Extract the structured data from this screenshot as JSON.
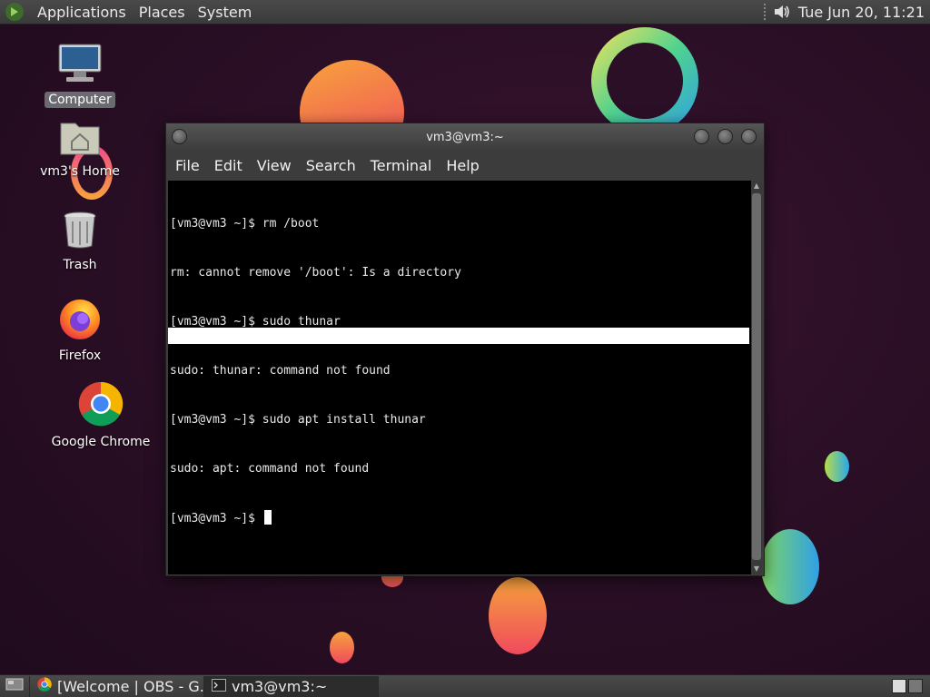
{
  "top_panel": {
    "menus": [
      "Applications",
      "Places",
      "System"
    ],
    "clock": "Tue Jun 20, 11:21"
  },
  "desktop": {
    "icons": [
      {
        "label": "Computer",
        "icon": "computer-icon",
        "selected": true
      },
      {
        "label": "vm3's Home",
        "icon": "home-folder-icon",
        "selected": false
      },
      {
        "label": "Trash",
        "icon": "trash-icon",
        "selected": false
      },
      {
        "label": "Firefox",
        "icon": "firefox-icon",
        "selected": false
      },
      {
        "label": "Google Chrome",
        "icon": "chrome-icon",
        "selected": false
      }
    ]
  },
  "terminal": {
    "title": "vm3@vm3:~",
    "menu": [
      "File",
      "Edit",
      "View",
      "Search",
      "Terminal",
      "Help"
    ],
    "lines": [
      "[vm3@vm3 ~]$ rm /boot",
      "rm: cannot remove '/boot': Is a directory",
      "[vm3@vm3 ~]$ sudo thunar",
      "sudo: thunar: command not found",
      "[vm3@vm3 ~]$ sudo apt install thunar",
      "sudo: apt: command not found",
      "[vm3@vm3 ~]$ "
    ]
  },
  "bottom_panel": {
    "tasks": [
      {
        "label": "[Welcome | OBS - G...",
        "icon": "chrome-icon",
        "active": false
      },
      {
        "label": "vm3@vm3:~",
        "icon": "terminal-icon",
        "active": true
      }
    ]
  },
  "colors": {
    "panel": "#3f3f3f",
    "wallpaper": "#2b0f26"
  }
}
